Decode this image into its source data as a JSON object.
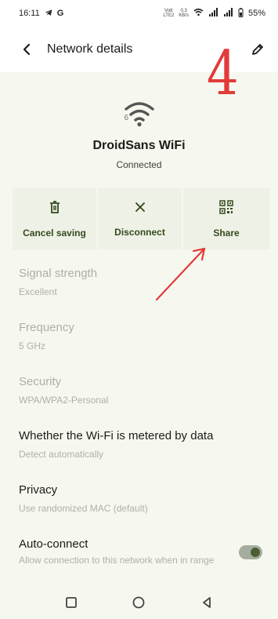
{
  "status_bar": {
    "time": "16:11",
    "carrier_letter": "G",
    "volte_top": "Vo8",
    "volte_bottom": "LTE2",
    "speed_top": "0.3",
    "speed_bottom": "KB/s",
    "battery": "55%"
  },
  "header": {
    "title": "Network details"
  },
  "annotation": {
    "step": "4",
    "color": "#e23b3b"
  },
  "network": {
    "wifi_generation": "6",
    "name": "DroidSans WiFi",
    "status": "Connected"
  },
  "actions": [
    {
      "label": "Cancel saving",
      "icon": "trash-icon"
    },
    {
      "label": "Disconnect",
      "icon": "close-icon"
    },
    {
      "label": "Share",
      "icon": "qr-code-icon"
    }
  ],
  "details": [
    {
      "title": "Signal strength",
      "value": "Excellent",
      "enabled": false
    },
    {
      "title": "Frequency",
      "value": "5 GHz",
      "enabled": false
    },
    {
      "title": "Security",
      "value": "WPA/WPA2-Personal",
      "enabled": false
    },
    {
      "title": "Whether the Wi-Fi is metered by data",
      "value": "Detect automatically",
      "enabled": true
    },
    {
      "title": "Privacy",
      "value": "Use randomized MAC (default)",
      "enabled": true
    },
    {
      "title": "Auto-connect",
      "value": "Allow connection to this network when in range",
      "enabled": true
    }
  ],
  "auto_connect_toggle": {
    "state": "on",
    "accent": "#4b5e35"
  },
  "colors": {
    "background": "#f6f8ef",
    "action_tile": "#eef1e5",
    "action_text": "#344b1e"
  },
  "navigation": {
    "recent": "square-nav-icon",
    "home": "circle-home-icon",
    "back": "triangle-back-icon"
  }
}
